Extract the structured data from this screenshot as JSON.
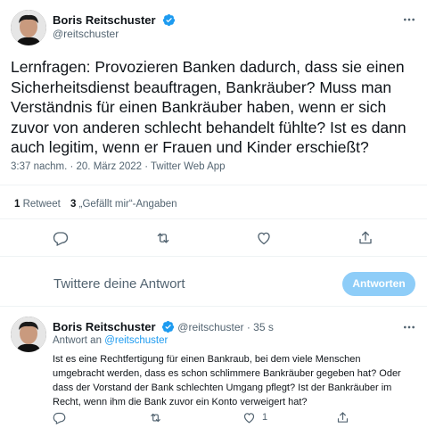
{
  "tweet": {
    "author_name": "Boris Reitschuster",
    "author_handle": "@reitschuster",
    "text": "Lernfragen: Provozieren Banken dadurch, dass sie einen Sicherheitsdienst beauftragen, Bankräuber? Muss man Verständnis für einen Bankräuber haben, wenn er sich zuvor von anderen schlecht behandelt fühlte? Ist es dann auch legitim, wenn er Frauen und Kinder erschießt?",
    "timestamp": "3:37 nachm. · 20. März 2022 · Twitter Web App",
    "retweet_count": "1",
    "retweet_label": "Retweet",
    "like_count": "3",
    "like_label": "„Gefällt mir“-Angaben"
  },
  "compose": {
    "placeholder": "Twittere deine Antwort",
    "button_label": "Antworten"
  },
  "reply": {
    "author_name": "Boris Reitschuster",
    "author_handle": "@reitschuster",
    "time": "· 35 s",
    "reply_to_prefix": "Antwort an",
    "reply_to_handle": "@reitschuster",
    "text": "Ist es eine Rechtfertigung für einen Bankraub, bei dem viele Menschen umgebracht werden, dass es schon schlimmere Bankräuber gegeben hat? Oder dass der Vorstand der Bank schlechten Umgang pflegt? Ist der Bankräuber im Recht, wenn ihm die Bank zuvor ein Konto verweigert hat?",
    "like_count": "1"
  },
  "icons": {
    "verified": "verified-badge-icon",
    "more": "more-icon",
    "reply": "reply-icon",
    "retweet": "retweet-icon",
    "like": "like-icon",
    "share": "share-icon"
  },
  "colors": {
    "accent": "#1d9bf0",
    "accent_disabled": "#8ecdf8",
    "text": "#0f1419",
    "muted": "#536471",
    "divider": "#eff3f4"
  }
}
